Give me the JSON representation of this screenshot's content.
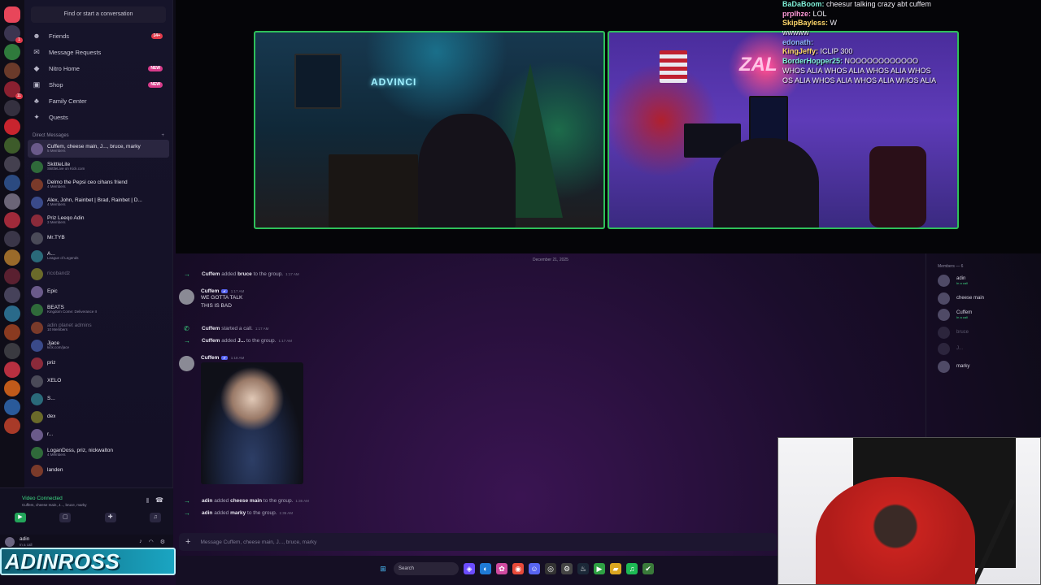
{
  "sidebar": {
    "find_placeholder": "Find or start a conversation",
    "nav": [
      {
        "label": "Friends",
        "icon": "friends-icon",
        "badge": "14+"
      },
      {
        "label": "Message Requests",
        "icon": "envelope-icon",
        "badge": ""
      },
      {
        "label": "Nitro Home",
        "icon": "nitro-icon",
        "badge": "NEW"
      },
      {
        "label": "Shop",
        "icon": "shop-icon",
        "badge": "NEW"
      },
      {
        "label": "Family Center",
        "icon": "family-icon",
        "badge": ""
      },
      {
        "label": "Quests",
        "icon": "quests-icon",
        "badge": ""
      }
    ],
    "dm_header": "Direct Messages",
    "dm_plus": "+",
    "dms": [
      {
        "name": "Cuffem, cheese main, J..., bruce, marky",
        "sub": "5 Members",
        "active": true
      },
      {
        "name": "SkittleLite",
        "sub": "SkittleLive on Kick.com"
      },
      {
        "name": "Delmo the Pepsi ceo cihans friend",
        "sub": "4 Members"
      },
      {
        "name": "Alex, John, Rainbet | Brad, Rainbet | D...",
        "sub": "4 Members"
      },
      {
        "name": "Priz Leeqo Adin",
        "sub": "3 Members"
      },
      {
        "name": "Mr.TYB",
        "sub": ""
      },
      {
        "name": "A...",
        "sub": "League of Legends"
      },
      {
        "name": "ricobandz",
        "sub": "",
        "dim": true
      },
      {
        "name": "Epic",
        "sub": ""
      },
      {
        "name": "BEATS",
        "sub": "Kingdom Come: Deliverance II"
      },
      {
        "name": "adin planet admins",
        "sub": "10 Members",
        "dim": true
      },
      {
        "name": "Jjace",
        "sub": "kick.com/jace"
      },
      {
        "name": "priz",
        "sub": ""
      },
      {
        "name": "XELO",
        "sub": ""
      },
      {
        "name": "S...",
        "sub": ""
      },
      {
        "name": "dex",
        "sub": ""
      },
      {
        "name": "r...",
        "sub": ""
      },
      {
        "name": "LoganDoss, priz, nickwalton",
        "sub": "4 Members"
      },
      {
        "name": "landen",
        "sub": ""
      }
    ],
    "voice": {
      "status": "Video Connected",
      "channel": "Cuffem, cheese main, J..., bruce, marky"
    },
    "user": {
      "name": "adin",
      "status": "In a call"
    }
  },
  "brand_text": "ADINROSS",
  "stream_chat": [
    {
      "user": "BaDaBoom:",
      "text": "cheesur talking crazy abt cuffem",
      "color": "teal"
    },
    {
      "user": "prplhze:",
      "text": "LOL",
      "color": "pink"
    },
    {
      "user": "SkipBayless:",
      "text": "W",
      "color": "gold"
    },
    {
      "user": "",
      "text": "wwwww",
      "color": "teal"
    },
    {
      "user": "edonath:",
      "text": "",
      "color": "blue"
    },
    {
      "user": "KingJeffy:",
      "text": "ICLIP 300",
      "color": "gold"
    },
    {
      "user": "BorderHopper25:",
      "text": "NOOOOOOOOOOOO",
      "color": "teal"
    },
    {
      "user": "",
      "text": "WHOS ALIA WHOS ALIA WHOS ALIA WHOS",
      "color": "teal"
    },
    {
      "user": "",
      "text": "OS ALIA WHOS ALIA WHOS ALIA WHOS ALIA",
      "color": "teal"
    }
  ],
  "video_left": {
    "logo_text": "ADVINCI"
  },
  "video_right": {
    "neon_text": "ZAL"
  },
  "chat": {
    "date_divider": "December 21, 2025",
    "items": [
      {
        "kind": "sys",
        "icon": "arrow",
        "user": "Cuffem",
        "mid": "added",
        "target": "bruce",
        "end": "to the group.",
        "ts": "1:17 AM"
      },
      {
        "kind": "msg",
        "user": "Cuffem",
        "ts": "1:17 AM",
        "lines": [
          "WE GOTTA TALK",
          "THIS IS BAD"
        ]
      },
      {
        "kind": "sys",
        "icon": "phone",
        "user": "Cuffem",
        "mid": "started a call.",
        "target": "",
        "end": "",
        "ts": "1:17 AM"
      },
      {
        "kind": "sys",
        "icon": "arrow",
        "user": "Cuffem",
        "mid": "added",
        "target": "J...",
        "end": "to the group.",
        "ts": "1:17 AM"
      },
      {
        "kind": "msg",
        "user": "Cuffem",
        "ts": "1:18 AM",
        "lines": []
      },
      {
        "kind": "sys",
        "icon": "arrow",
        "user": "adin",
        "mid": "added",
        "target": "cheese main",
        "end": "to the group.",
        "ts": "1:36 AM"
      },
      {
        "kind": "sys",
        "icon": "arrow",
        "user": "adin",
        "mid": "added",
        "target": "marky",
        "end": "to the group.",
        "ts": "1:36 AM"
      }
    ],
    "composer_placeholder": "Message Cuffem, cheese main, J..., bruce, marky"
  },
  "members": {
    "title": "Members — 6",
    "list": [
      {
        "name": "adin",
        "status": "In a call"
      },
      {
        "name": "cheese main",
        "status": ""
      },
      {
        "name": "Cuffem",
        "status": "In a call"
      },
      {
        "name": "bruce",
        "status": "",
        "dim": true
      },
      {
        "name": "J...",
        "status": "",
        "dim": true
      },
      {
        "name": "marky",
        "status": ""
      }
    ]
  },
  "taskbar": {
    "search_label": "Search"
  },
  "colors": {
    "accent_green": "#3ddc84",
    "call_border": "#2ec05a",
    "badge_red": "#e23b4b",
    "blurple": "#5865f2"
  }
}
